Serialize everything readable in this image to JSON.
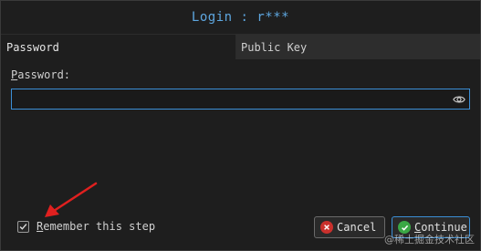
{
  "dialog": {
    "title": "Login : r***"
  },
  "tabs": [
    {
      "label": "Password",
      "active": true
    },
    {
      "label": "Public Key",
      "active": false
    }
  ],
  "password_field": {
    "label_underlined": "P",
    "label_rest": "assword:",
    "value": "",
    "placeholder": ""
  },
  "remember": {
    "checked": true,
    "label_underlined": "R",
    "label_rest": "emember this step"
  },
  "buttons": {
    "cancel_label": "Cancel",
    "continue_underlined": "C",
    "continue_rest": "ontinue"
  },
  "icons": {
    "password_toggle": "eye-icon",
    "cancel": "x-circle-icon",
    "continue": "check-circle-icon",
    "annotation": "red-arrow"
  },
  "colors": {
    "accent": "#3b8fd6",
    "title": "#5ea7e0",
    "annotation_arrow": "#e0201f",
    "cancel_icon": "#c9302c",
    "continue_icon": "#3aa845"
  },
  "watermark": "@稀土掘金技术社区"
}
